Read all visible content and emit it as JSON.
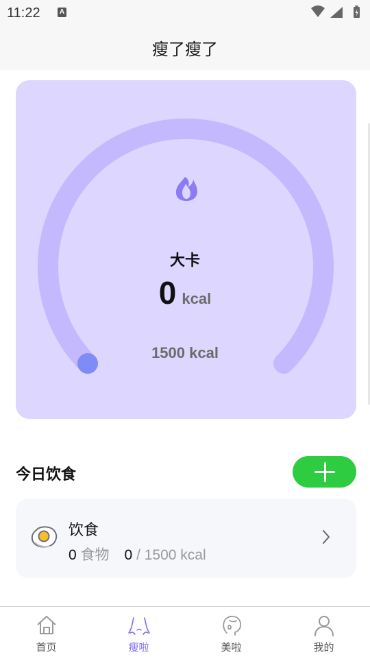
{
  "status_bar": {
    "time": "11:22",
    "notification_icon": "a-letter-icon"
  },
  "header": {
    "title": "瘦了瘦了"
  },
  "gauge": {
    "icon": "flame-icon",
    "label": "大卡",
    "value": "0",
    "unit": "kcal",
    "target": "1500 kcal",
    "progress": 0,
    "colors": {
      "card": "#ddd6fe",
      "track": "#c4b8ff",
      "knob": "#7f8cf7",
      "flame": "#8b7cf6"
    }
  },
  "today": {
    "title": "今日饮食",
    "add_icon": "plus-icon"
  },
  "diet_card": {
    "icon": "fried-egg-icon",
    "title": "饮食",
    "food_count": "0",
    "food_label": "食物",
    "kcal_value": "0",
    "kcal_rest": "/ 1500 kcal"
  },
  "nav": {
    "items": [
      {
        "label": "首页",
        "icon": "home-icon",
        "active": false
      },
      {
        "label": "瘦啦",
        "icon": "body-icon",
        "active": true
      },
      {
        "label": "美啦",
        "icon": "face-icon",
        "active": false
      },
      {
        "label": "我的",
        "icon": "user-icon",
        "active": false
      }
    ],
    "active_color": "#7c6cf0"
  }
}
